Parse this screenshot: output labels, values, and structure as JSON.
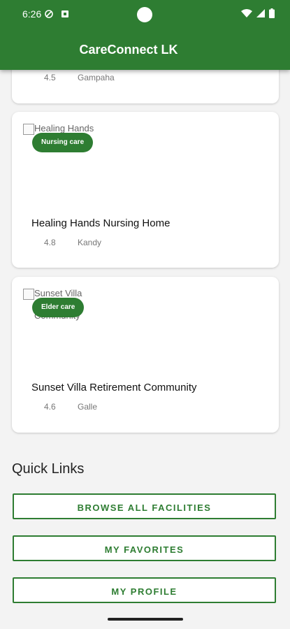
{
  "status_bar": {
    "time": "6:26"
  },
  "app": {
    "title": "CareConnect LK",
    "accent": "#2e7d32"
  },
  "partial_card": {
    "rating": "4.5",
    "location": "Gampaha"
  },
  "cards": [
    {
      "image_alt": "Healing Hands Nursing Home",
      "badge": "Nursing care",
      "title": "Healing Hands Nursing Home",
      "rating": "4.8",
      "location": "Kandy"
    },
    {
      "image_alt": "Sunset Villa Retirement Community",
      "badge": "Elder care",
      "title": "Sunset Villa Retirement Community",
      "rating": "4.6",
      "location": "Galle"
    }
  ],
  "quick_links": {
    "title": "Quick Links",
    "buttons": [
      "BROWSE ALL FACILITIES",
      "MY FAVORITES",
      "MY PROFILE"
    ]
  },
  "icons": [
    "signal-icon",
    "wifi-icon",
    "battery-icon",
    "broken-image-icon"
  ]
}
